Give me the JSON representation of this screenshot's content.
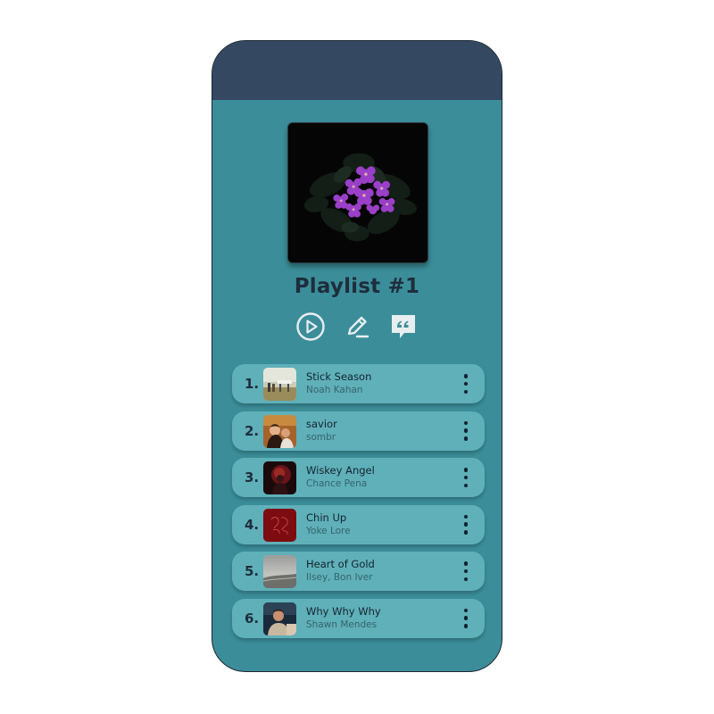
{
  "playlist": {
    "title": "Playlist #1",
    "cover_icon": "violet-flowers-artwork"
  },
  "actions": {
    "play_icon": "play-circle-icon",
    "edit_icon": "pencil-icon",
    "quote_icon": "quote-bubble-icon"
  },
  "songs": [
    {
      "number": "1.",
      "title": "Stick Season",
      "artist": "Noah Kahan"
    },
    {
      "number": "2.",
      "title": "savior",
      "artist": "sombr"
    },
    {
      "number": "3.",
      "title": "Wiskey Angel",
      "artist": "Chance Pena"
    },
    {
      "number": "4.",
      "title": "Chin Up",
      "artist": "Yoke Lore"
    },
    {
      "number": "5.",
      "title": "Heart of Gold",
      "artist": "Ilsey, Bon Iver"
    },
    {
      "number": "6.",
      "title": "Why Why Why",
      "artist": "Shawn Mendes"
    }
  ],
  "colors": {
    "header": "#354862",
    "background": "#3b8e99",
    "card": "#5fb0b9",
    "text_dark": "#1e2d3c",
    "icon_light": "#e8eef0"
  }
}
